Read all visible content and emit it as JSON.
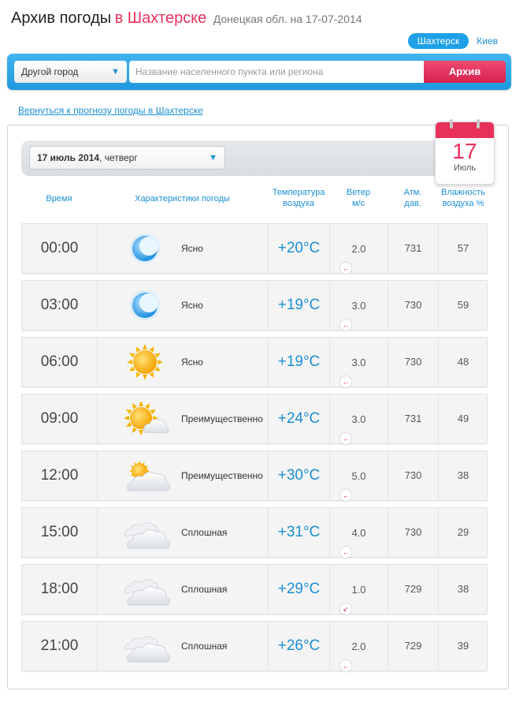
{
  "header": {
    "title_part1": "Архив погоды",
    "title_part2": "в Шахтерске",
    "subtitle": "Донецкая обл. на 17-07-2014"
  },
  "city_links": {
    "active": "Шахтерск",
    "other": "Киев"
  },
  "search": {
    "city_select_label": "Другой город",
    "placeholder": "Название населенного пункта или региона",
    "button_label": "Архив"
  },
  "back_link": "Вернуться к прогнозу погоды в Шахтерске",
  "date": {
    "bold": "17 июль 2014",
    "rest": ", четверг",
    "calendar_day": "17",
    "calendar_month": "Июль"
  },
  "columns": {
    "time": "Время",
    "conditions": "Характеристики погоды",
    "temperature": [
      "Температура",
      "воздуха"
    ],
    "wind": [
      "Ветер",
      "м/с"
    ],
    "pressure": [
      "Атм.",
      "дав."
    ],
    "humidity": [
      "Влажность",
      "воздуха %"
    ]
  },
  "rows": [
    {
      "time": "00:00",
      "icon": "moon-icon",
      "condition": "Ясно",
      "temp": "+20°C",
      "wind": "2.0",
      "wind_dir": "←",
      "pressure": "731",
      "humidity": "57"
    },
    {
      "time": "03:00",
      "icon": "moon-icon",
      "condition": "Ясно",
      "temp": "+19°C",
      "wind": "3.0",
      "wind_dir": "←",
      "pressure": "730",
      "humidity": "59"
    },
    {
      "time": "06:00",
      "icon": "sun-icon",
      "condition": "Ясно",
      "temp": "+19°C",
      "wind": "3.0",
      "wind_dir": "←",
      "pressure": "730",
      "humidity": "48"
    },
    {
      "time": "09:00",
      "icon": "sun-cloud-icon",
      "condition": "Преимущественно",
      "temp": "+24°C",
      "wind": "3.0",
      "wind_dir": "←",
      "pressure": "731",
      "humidity": "49"
    },
    {
      "time": "12:00",
      "icon": "cloud-sun-icon",
      "condition": "Преимущественно",
      "temp": "+30°C",
      "wind": "5.0",
      "wind_dir": "←",
      "pressure": "730",
      "humidity": "38"
    },
    {
      "time": "15:00",
      "icon": "cloud-icon",
      "condition": "Сплошная",
      "temp": "+31°C",
      "wind": "4.0",
      "wind_dir": "←",
      "pressure": "730",
      "humidity": "29"
    },
    {
      "time": "18:00",
      "icon": "cloud-icon",
      "condition": "Сплошная",
      "temp": "+29°C",
      "wind": "1.0",
      "wind_dir": "↙",
      "pressure": "729",
      "humidity": "38"
    },
    {
      "time": "21:00",
      "icon": "cloud-icon",
      "condition": "Сплошная",
      "temp": "+26°C",
      "wind": "2.0",
      "wind_dir": "←",
      "pressure": "729",
      "humidity": "39"
    }
  ],
  "colors": {
    "accent_blue": "#1a8fd4",
    "accent_red": "#e8315a"
  }
}
